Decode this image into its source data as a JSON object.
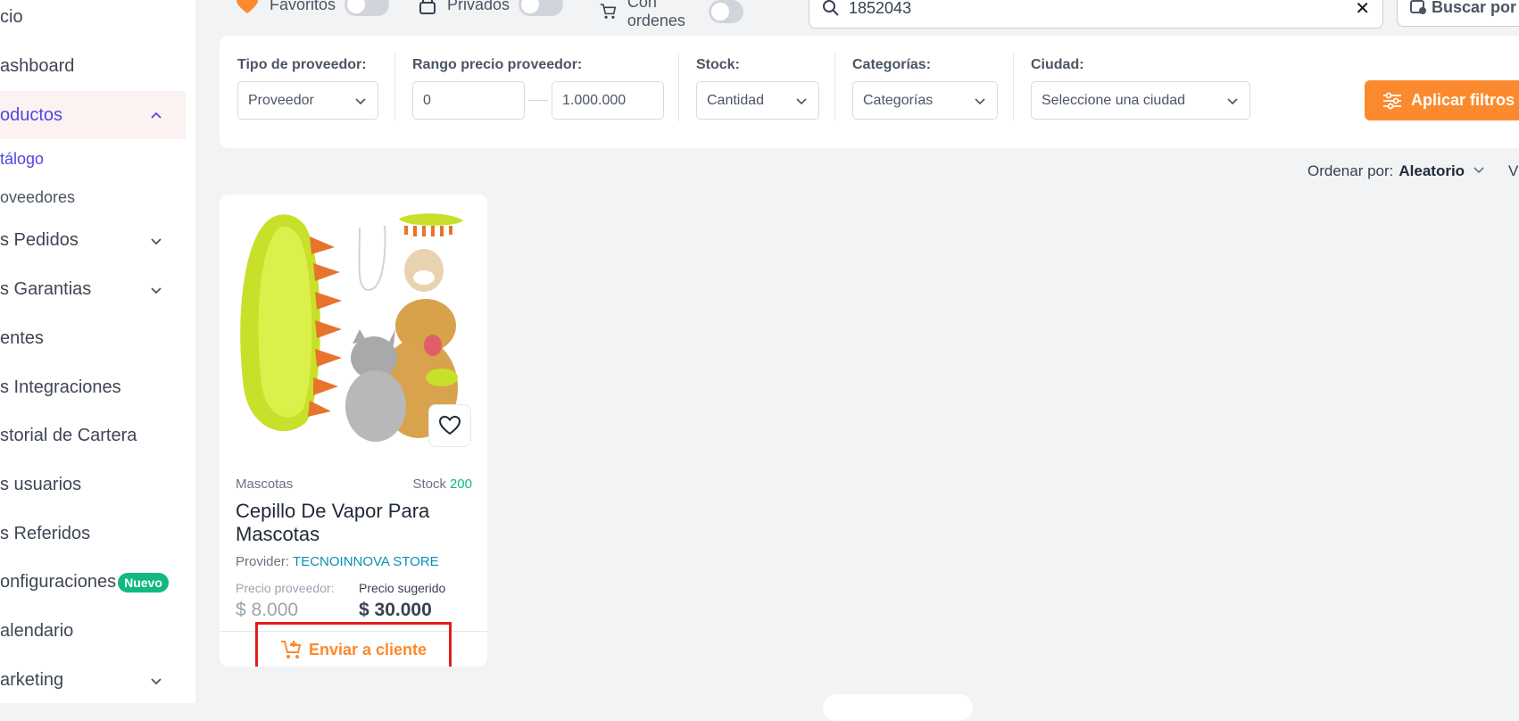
{
  "sidebar": {
    "items": [
      {
        "label": "cio"
      },
      {
        "label": "ashboard"
      },
      {
        "label": "oductos"
      },
      {
        "label": "s Pedidos"
      },
      {
        "label": "s Garantias"
      },
      {
        "label": "entes"
      },
      {
        "label": "s Integraciones"
      },
      {
        "label": "storial de Cartera"
      },
      {
        "label": "s usuarios"
      },
      {
        "label": "s Referidos"
      },
      {
        "label": "onfiguraciones"
      },
      {
        "label": "alendario"
      },
      {
        "label": "arketing"
      }
    ],
    "subitems": [
      {
        "label": "tálogo"
      },
      {
        "label": "oveedores"
      }
    ],
    "badge": "Nuevo"
  },
  "toggles": {
    "favoritos": "Favoritos",
    "privados": "Privados",
    "con_ordenes": "Con ordenes"
  },
  "search": {
    "value": "1852043",
    "clear": "✕",
    "buscar_label": "Buscar por"
  },
  "filters": {
    "tipo_label": "Tipo de proveedor:",
    "tipo_value": "Proveedor",
    "rango_label": "Rango precio proveedor:",
    "rango_min": "0",
    "rango_max": "1.000.000",
    "stock_label": "Stock:",
    "stock_value": "Cantidad",
    "categorias_label": "Categorías:",
    "categorias_value": "Categorías",
    "ciudad_label": "Ciudad:",
    "ciudad_value": "Seleccione una ciudad",
    "apply_label": "Aplicar filtros"
  },
  "sort": {
    "label": "Ordenar por:",
    "value": "Aleatorio",
    "view": "Vi"
  },
  "product": {
    "category": "Mascotas",
    "stock_label": "Stock",
    "stock_value": "200",
    "name": "Cepillo De Vapor Para Mascotas",
    "provider_label": "Provider:",
    "provider_name": "TECNOINNOVA STORE",
    "price_provider_label": "Precio proveedor:",
    "price_suggested_label": "Precio sugerido",
    "price_provider": "$ 8.000",
    "price_suggested": "$ 30.000",
    "send_label": "Enviar a cliente"
  },
  "colors": {
    "accent_orange": "#fb8a2e",
    "active_purple": "#4f46e5",
    "stock_green": "#10b981",
    "provider_cyan": "#0891b2",
    "highlight_red": "#e11d1d"
  }
}
